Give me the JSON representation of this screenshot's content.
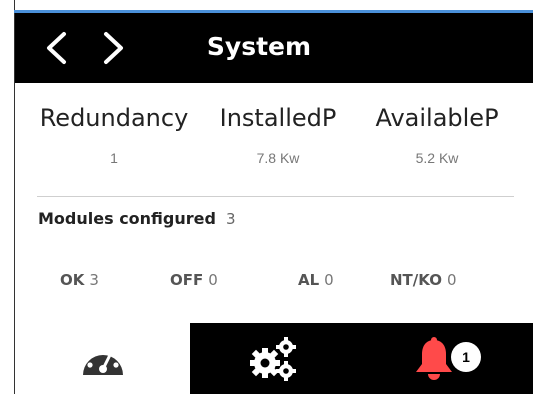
{
  "header": {
    "title": "System",
    "prev_icon": "chevron-left-icon",
    "next_icon": "chevron-right-icon"
  },
  "stats": [
    {
      "label": "Redundancy",
      "value": "1"
    },
    {
      "label": "InstalledP",
      "value": "7.8 Kw"
    },
    {
      "label": "AvailableP",
      "value": "5.2 Kw"
    }
  ],
  "modules": {
    "label": "Modules configured",
    "count": "3"
  },
  "statuses": [
    {
      "key": "OK",
      "value": "3"
    },
    {
      "key": "OFF",
      "value": "0"
    },
    {
      "key": "AL",
      "value": "0"
    },
    {
      "key": "NT/KO",
      "value": "0"
    }
  ],
  "tabbar": {
    "dashboard_icon": "gauge-icon",
    "settings_icon": "gears-icon",
    "alarm_icon": "bell-icon",
    "alarm_badge": "1",
    "alarm_color": "#ff4a4a"
  },
  "colors": {
    "header_bg": "#000000",
    "accent_line": "#4a90d9"
  }
}
